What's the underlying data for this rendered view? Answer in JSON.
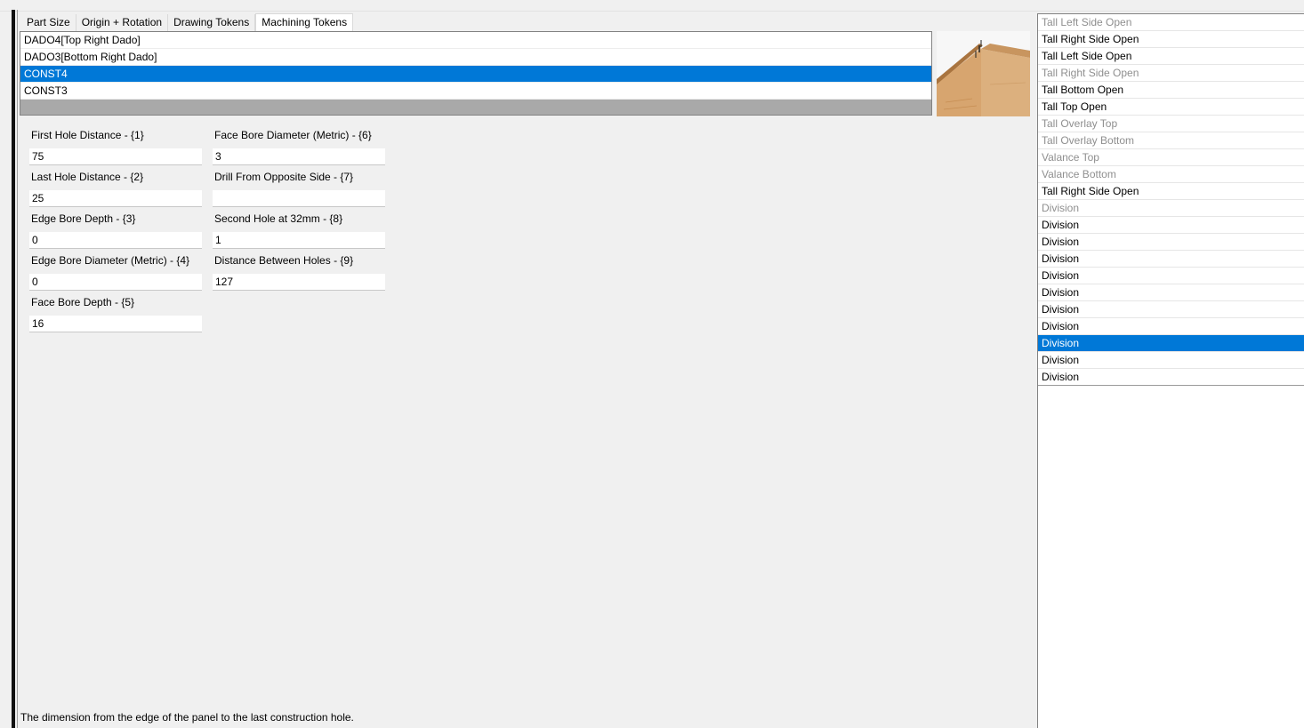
{
  "tabs": [
    "Part Size",
    "Origin + Rotation",
    "Drawing Tokens",
    "Machining Tokens"
  ],
  "active_tab": 3,
  "token_list": [
    "DADO4[Top Right Dado]",
    "DADO3[Bottom Right Dado]",
    "CONST4",
    "CONST3"
  ],
  "selected_token": 2,
  "fields": {
    "first_hole_distance": {
      "label": "First Hole Distance - {1}",
      "value": "75"
    },
    "last_hole_distance": {
      "label": "Last Hole Distance - {2}",
      "value": "25"
    },
    "edge_bore_depth": {
      "label": "Edge Bore Depth - {3}",
      "value": "0"
    },
    "edge_bore_diameter": {
      "label": "Edge Bore Diameter (Metric) - {4}",
      "value": "0"
    },
    "face_bore_depth": {
      "label": "Face Bore Depth - {5}",
      "value": "16"
    },
    "face_bore_diameter": {
      "label": "Face Bore Diameter (Metric) - {6}",
      "value": "3"
    },
    "drill_from_opposite": {
      "label": "Drill From Opposite Side - {7}",
      "value": ""
    },
    "second_hole_32mm": {
      "label": "Second Hole at 32mm - {8}",
      "value": "1"
    },
    "distance_between_holes": {
      "label": "Distance Between Holes - {9}",
      "value": "127"
    }
  },
  "status_text": "The dimension from the edge of the panel to the last construction hole.",
  "part_list": [
    {
      "label": "Tall Left Side Open",
      "dim": true
    },
    {
      "label": "Tall Right Side Open",
      "dim": false
    },
    {
      "label": "Tall Left Side Open",
      "dim": false
    },
    {
      "label": "Tall Right Side Open",
      "dim": true
    },
    {
      "label": "Tall Bottom Open",
      "dim": false
    },
    {
      "label": "Tall Top Open",
      "dim": false
    },
    {
      "label": "Tall Overlay Top",
      "dim": true
    },
    {
      "label": "Tall Overlay Bottom",
      "dim": true
    },
    {
      "label": "Valance Top",
      "dim": true
    },
    {
      "label": "Valance Bottom",
      "dim": true
    },
    {
      "label": "Tall Right Side Open",
      "dim": false
    },
    {
      "label": "Division",
      "dim": true
    },
    {
      "label": "Division",
      "dim": false
    },
    {
      "label": "Division",
      "dim": false
    },
    {
      "label": "Division",
      "dim": false
    },
    {
      "label": "Division",
      "dim": false
    },
    {
      "label": "Division",
      "dim": false
    },
    {
      "label": "Division",
      "dim": false
    },
    {
      "label": "Division",
      "dim": false
    },
    {
      "label": "Division",
      "dim": false
    },
    {
      "label": "Division",
      "dim": false
    },
    {
      "label": "Division",
      "dim": false
    }
  ],
  "selected_part": 19,
  "colors": {
    "selection": "#0078d7",
    "dim_text": "#8f8f8f"
  },
  "preview_image": "wood-panel-dado"
}
